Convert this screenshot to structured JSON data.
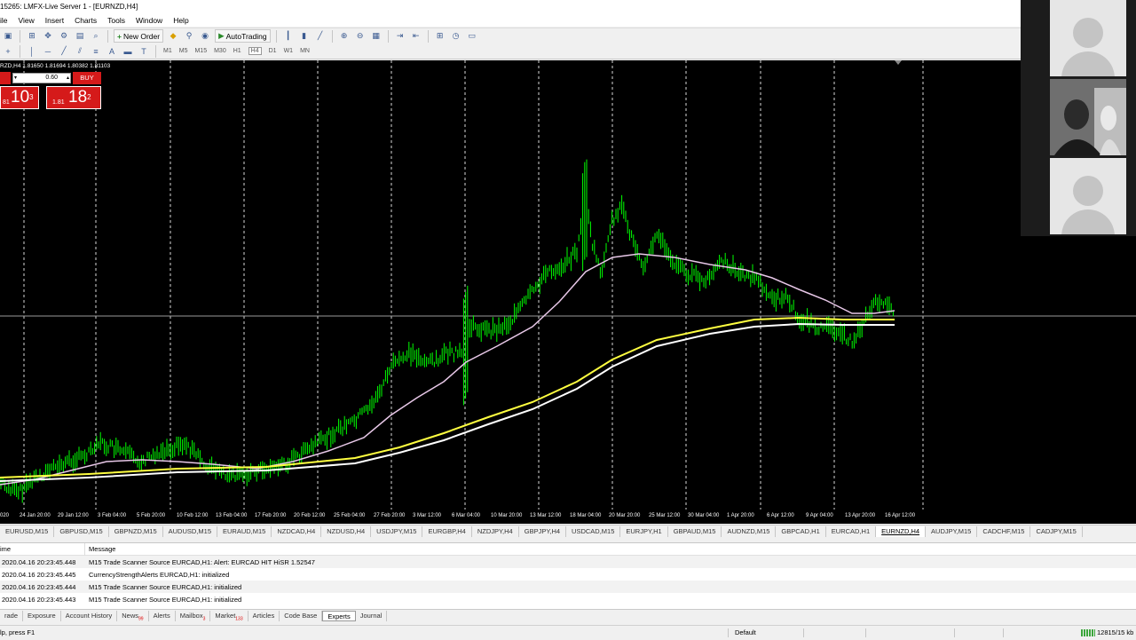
{
  "window": {
    "title": "15265: LMFX-Live Server 1 - [EURNZD,H4]"
  },
  "menu": [
    "ile",
    "View",
    "Insert",
    "Charts",
    "Tools",
    "Window",
    "Help"
  ],
  "toolbar": {
    "new_order_label": "New Order",
    "autotrading_label": "AutoTrading",
    "timeframes": [
      "M1",
      "M5",
      "M15",
      "M30",
      "H1",
      "H4",
      "D1",
      "W1",
      "MN"
    ]
  },
  "chart": {
    "info_line": "RZD,H4  1.81650 1.81694 1.80382 1.81103",
    "one_click": {
      "lot_value": "0.60",
      "buy_label": "BUY",
      "sell_small": "81",
      "sell_big": "10",
      "sell_sup": "3",
      "buy_small": "1.81",
      "buy_big": "18",
      "buy_sup": "2"
    },
    "date_labels": [
      "020",
      "24 Jan 20:00",
      "29 Jan 12:00",
      "3 Feb 04:00",
      "5 Feb 20:00",
      "10 Feb 12:00",
      "13 Feb 04:00",
      "17 Feb 20:00",
      "20 Feb 12:00",
      "25 Feb 04:00",
      "27 Feb 20:00",
      "3 Mar 12:00",
      "6 Mar 04:00",
      "10 Mar 20:00",
      "13 Mar 12:00",
      "18 Mar 04:00",
      "20 Mar 20:00",
      "25 Mar 12:00",
      "30 Mar 04:00",
      "1 Apr 20:00",
      "6 Apr 12:00",
      "9 Apr 04:00",
      "13 Apr 20:00",
      "16 Apr 12:00"
    ],
    "colors": {
      "candles": "#00ff00",
      "ma_fast": "#e8c8e8",
      "ma_mid": "#ffff40",
      "ma_slow": "#ffffff",
      "grid": "#ffffff",
      "background": "#000000"
    }
  },
  "symbol_tabs": [
    "EURUSD,M15",
    "GBPUSD,M15",
    "GBPNZD,M15",
    "AUDUSD,M15",
    "EURAUD,M15",
    "NZDCAD,H4",
    "NZDUSD,H4",
    "USDJPY,M15",
    "EURGBP,H4",
    "NZDJPY,H4",
    "GBPJPY,H4",
    "USDCAD,M15",
    "EURJPY,H1",
    "GBPAUD,M15",
    "AUDNZD,M15",
    "GBPCAD,H1",
    "EURCAD,H1",
    "EURNZD,H4",
    "AUDJPY,M15",
    "CADCHF,M15",
    "CADJPY,M15"
  ],
  "active_symbol_tab": "EURNZD,H4",
  "terminal": {
    "col_time": "ime",
    "col_message": "Message",
    "rows": [
      {
        "time": "2020.04.16 20:23:45.448",
        "message": "M15 Trade Scanner Source EURCAD,H1: Alert: EURCAD HIT HiSR  1.52547"
      },
      {
        "time": "2020.04.16 20:23:45.445",
        "message": "CurrencyStrengthAlerts EURCAD,H1: initialized"
      },
      {
        "time": "2020.04.16 20:23:45.444",
        "message": "M15 Trade Scanner Source EURCAD,H1: initialized"
      },
      {
        "time": "2020.04.16 20:23:45.443",
        "message": "M15 Trade Scanner Source EURCAD,H1: initialized"
      }
    ],
    "tabs": [
      {
        "label": "rade"
      },
      {
        "label": "Exposure"
      },
      {
        "label": "Account History"
      },
      {
        "label": "News",
        "badge": "99"
      },
      {
        "label": "Alerts"
      },
      {
        "label": "Mailbox",
        "badge": "3"
      },
      {
        "label": "Market",
        "badge": "133"
      },
      {
        "label": "Articles"
      },
      {
        "label": "Code Base"
      },
      {
        "label": "Experts"
      },
      {
        "label": "Journal"
      }
    ],
    "active_tab": "Experts"
  },
  "status": {
    "help": "lp, press F1",
    "profile": "Default",
    "connection": "12815/15 kb"
  }
}
